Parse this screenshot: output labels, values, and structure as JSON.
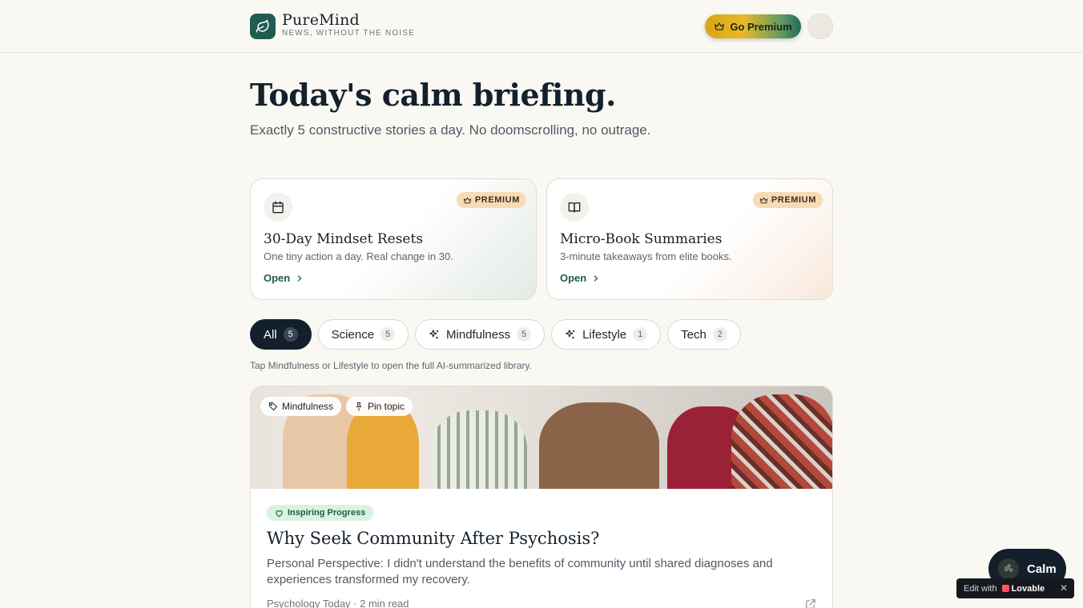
{
  "header": {
    "brand": "PureMind",
    "tagline": "NEWS, WITHOUT THE NOISE",
    "premium_label": "Go Premium",
    "logo_icon": "leaf-icon",
    "accent": "#1f5c52"
  },
  "hero": {
    "title": "Today's calm briefing.",
    "subtitle": "Exactly 5 constructive stories a day. No doomscrolling, no outrage."
  },
  "cards": [
    {
      "icon": "calendar-icon",
      "badge": "PREMIUM",
      "title": "30-Day Mindset Resets",
      "desc": "One tiny action a day. Real change in 30.",
      "open": "Open"
    },
    {
      "icon": "book-icon",
      "badge": "PREMIUM",
      "title": "Micro-Book Summaries",
      "desc": "3-minute takeaways from elite books.",
      "open": "Open"
    }
  ],
  "filters": [
    {
      "label": "All",
      "count": "5",
      "active": true
    },
    {
      "label": "Science",
      "count": "5"
    },
    {
      "label": "Mindfulness",
      "count": "5",
      "icon": "sparkles-icon"
    },
    {
      "label": "Lifestyle",
      "count": "1",
      "icon": "sparkles-icon"
    },
    {
      "label": "Tech",
      "count": "2"
    }
  ],
  "hint": "Tap Mindfulness or Lifestyle to open the full AI-summarized library.",
  "article": {
    "tag": "Mindfulness",
    "pin": "Pin topic",
    "badge": "Inspiring Progress",
    "title": "Why Seek Community After Psychosis?",
    "desc": "Personal Perspective: I didn't understand the benefits of community until shared diagnoses and experiences transformed my recovery.",
    "meta": "Psychology Today · 2 min read"
  },
  "calm_button": "Calm",
  "lovable": {
    "prefix": "Edit with",
    "name": "Lovable"
  }
}
